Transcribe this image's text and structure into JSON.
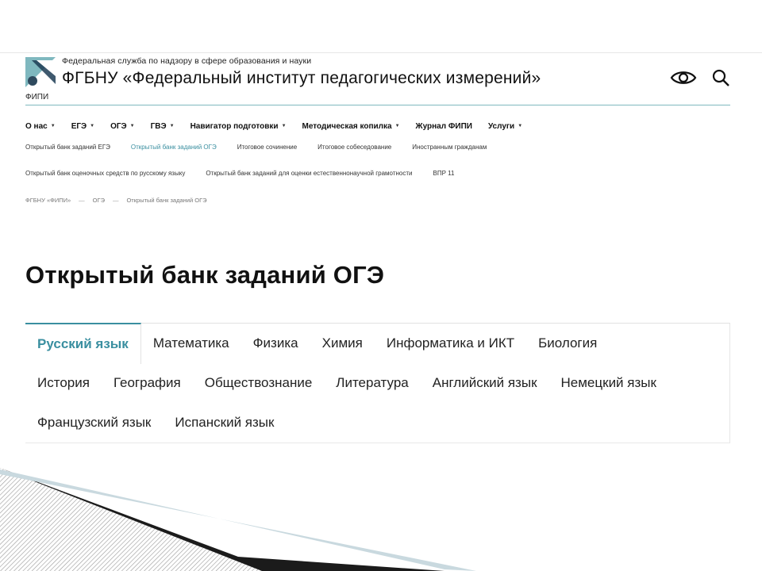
{
  "header": {
    "org_sub": "Федеральная служба по надзору в сфере образования и науки",
    "org_title": "ФГБНУ «Федеральный институт педагогических измерений»",
    "fipi_tag": "ФИПИ"
  },
  "main_nav": [
    {
      "label": "О нас",
      "dropdown": true
    },
    {
      "label": "ЕГЭ",
      "dropdown": true
    },
    {
      "label": "ОГЭ",
      "dropdown": true
    },
    {
      "label": "ГВЭ",
      "dropdown": true
    },
    {
      "label": "Навигатор подготовки",
      "dropdown": true
    },
    {
      "label": "Методическая копилка",
      "dropdown": true
    },
    {
      "label": "Журнал ФИПИ",
      "dropdown": false
    },
    {
      "label": "Услуги",
      "dropdown": true
    }
  ],
  "sub_links_row1": [
    {
      "label": "Открытый банк заданий ЕГЭ"
    },
    {
      "label": "Открытый банк заданий ОГЭ",
      "active": true
    },
    {
      "label": "Итоговое сочинение"
    },
    {
      "label": "Итоговое собеседование"
    },
    {
      "label": "Иностранным гражданам"
    }
  ],
  "sub_links_row2": [
    {
      "label": "Открытый банк оценочных средств по русскому языку"
    },
    {
      "label": "Открытый банк заданий для оценки естественнонаучной грамотности"
    },
    {
      "label": "ВПР 11"
    }
  ],
  "breadcrumb": [
    "ФГБНУ «ФИПИ»",
    "ОГЭ",
    "Открытый банк заданий ОГЭ"
  ],
  "breadcrumb_sep": "—",
  "page_title": "Открытый банк заданий ОГЭ",
  "subjects": [
    [
      "Русский язык",
      "Математика",
      "Физика",
      "Химия",
      "Информатика и ИКТ",
      "Биология"
    ],
    [
      "История",
      "География",
      "Обществознание",
      "Литература",
      "Английский язык",
      "Немецкий язык"
    ],
    [
      "Французский язык",
      "Испанский язык"
    ]
  ],
  "active_subject": "Русский язык",
  "colors": {
    "accent": "#3a8fa0",
    "header_line": "#7fb8bf"
  },
  "icons": [
    "eye-icon",
    "search-icon"
  ]
}
